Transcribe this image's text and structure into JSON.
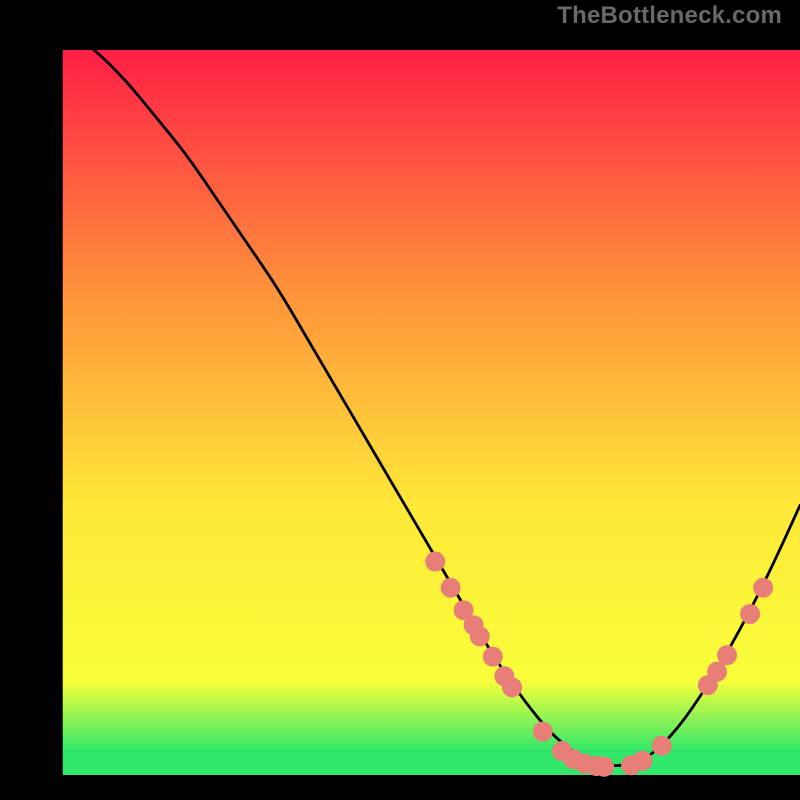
{
  "watermark": {
    "text": "TheBottleneck.com"
  },
  "colors": {
    "background": "#000000",
    "gradient_top": "#ff1f46",
    "gradient_mid1": "#ff943b",
    "gradient_mid2": "#ffe838",
    "gradient_mid3": "#f8ff3a",
    "gradient_bottom": "#32e86b",
    "curve": "#000000",
    "marker": "#e77f78"
  },
  "chart_data": {
    "type": "line",
    "title": "",
    "xlabel": "",
    "ylabel": "",
    "xlim": [
      0,
      100
    ],
    "ylim": [
      0,
      100
    ],
    "series": [
      {
        "name": "curve",
        "x": [
          0,
          4,
          8,
          12,
          16,
          20,
          24,
          28,
          32,
          36,
          40,
          44,
          48,
          52,
          56,
          60,
          64,
          68,
          72,
          76,
          80,
          84,
          88,
          92,
          96,
          100
        ],
        "y": [
          100,
          100,
          97,
          93,
          88,
          83,
          77,
          71,
          65,
          58,
          51,
          44,
          37,
          30,
          23,
          16,
          10,
          5,
          2,
          1,
          2,
          6,
          12,
          19,
          27,
          36
        ]
      }
    ],
    "markers": [
      {
        "x": 52.5,
        "y": 28.5
      },
      {
        "x": 54.5,
        "y": 25.0
      },
      {
        "x": 56.2,
        "y": 22.0
      },
      {
        "x": 57.5,
        "y": 20.0
      },
      {
        "x": 58.3,
        "y": 18.5
      },
      {
        "x": 60.0,
        "y": 15.8
      },
      {
        "x": 61.5,
        "y": 13.2
      },
      {
        "x": 62.5,
        "y": 11.7
      },
      {
        "x": 66.5,
        "y": 5.8
      },
      {
        "x": 69.0,
        "y": 3.2
      },
      {
        "x": 70.5,
        "y": 2.1
      },
      {
        "x": 72.0,
        "y": 1.5
      },
      {
        "x": 73.5,
        "y": 1.2
      },
      {
        "x": 74.5,
        "y": 1.1
      },
      {
        "x": 78.0,
        "y": 1.3
      },
      {
        "x": 79.5,
        "y": 1.9
      },
      {
        "x": 82.0,
        "y": 3.9
      },
      {
        "x": 88.0,
        "y": 12.0
      },
      {
        "x": 89.2,
        "y": 13.8
      },
      {
        "x": 90.5,
        "y": 16.0
      },
      {
        "x": 93.5,
        "y": 21.5
      },
      {
        "x": 95.2,
        "y": 25.0
      }
    ],
    "marker_radius": 1.3,
    "gradient_rect": {
      "x": 4,
      "y": 3.2,
      "w": 96,
      "h": 93.6
    },
    "green_band": {
      "y0": 0.0,
      "y1": 3.2
    }
  }
}
